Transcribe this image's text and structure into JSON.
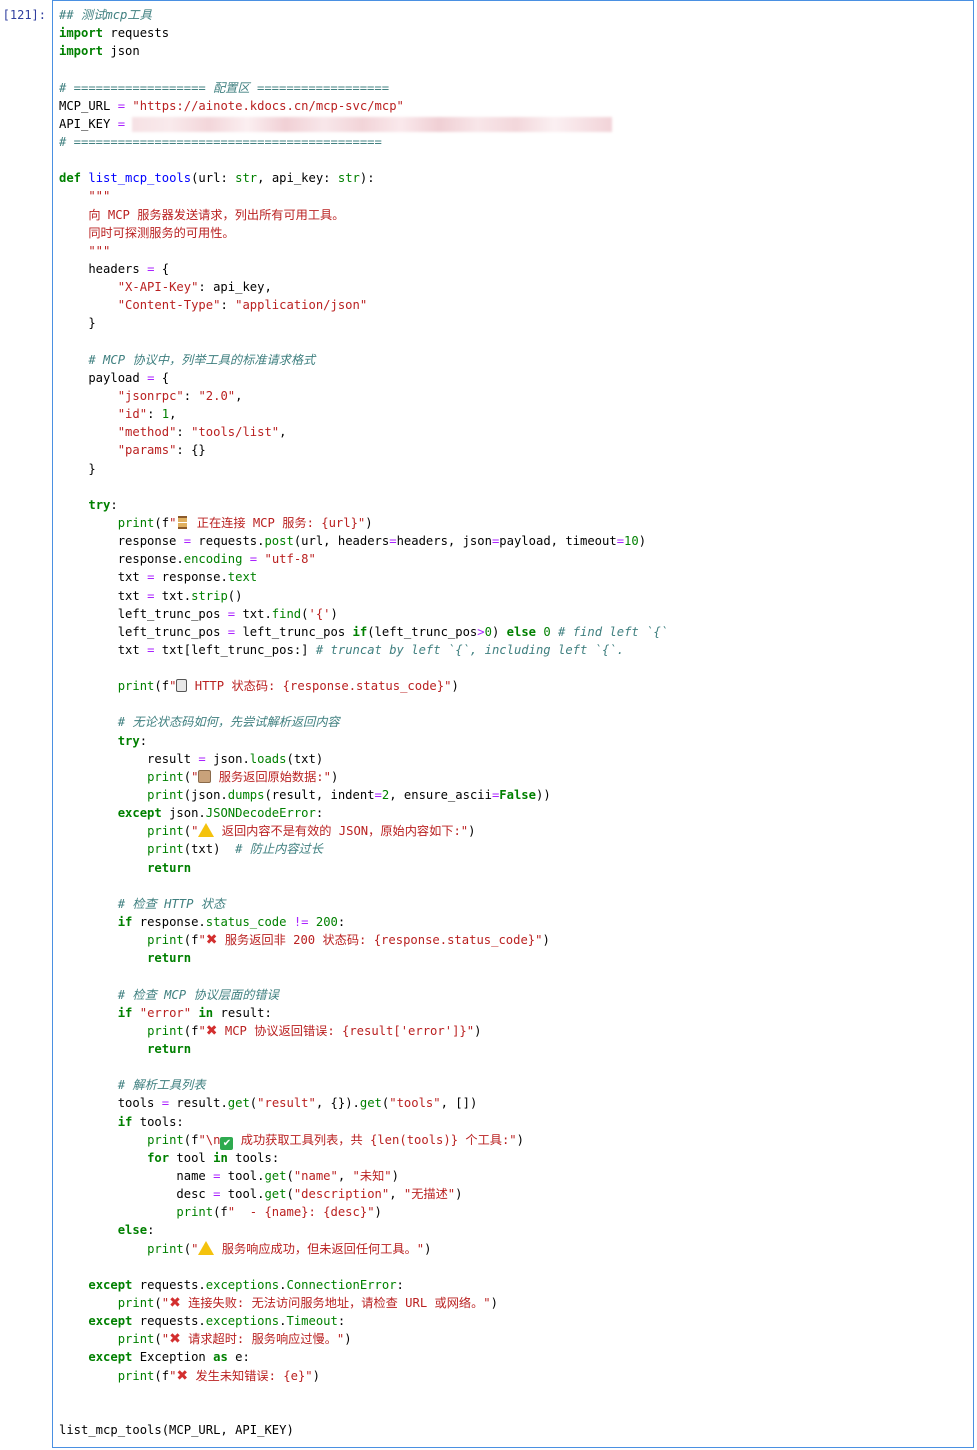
{
  "cell": {
    "prompt": "[121]:",
    "blank_line": " ",
    "code_lines": [
      "## 测试mcp工具",
      "import requests",
      "import json",
      "",
      "# ================== 配置区 ==================",
      "MCP_URL = \"https://ainote.kdocs.cn/mcp-svc/mcp\"",
      "API_KEY = ",
      "# ==========================================",
      "",
      "def list_mcp_tools(url: str, api_key: str):",
      "    \"\"\"",
      "    向 MCP 服务器发送请求，列出所有可用工具。",
      "    同时可探测服务的可用性。",
      "    \"\"\"",
      "    headers = {",
      "        \"X-API-Key\": api_key,",
      "        \"Content-Type\": \"application/json\"",
      "    }",
      "",
      "    # MCP 协议中，列举工具的标准请求格式",
      "    payload = {",
      "        \"jsonrpc\": \"2.0\",",
      "        \"id\": 1,",
      "        \"method\": \"tools/list\",",
      "        \"params\": {}",
      "    }",
      "",
      "    try:",
      "        print(f\"⏳ 正在连接 MCP 服务: {url}\")",
      "        response = requests.post(url, headers=headers, json=payload, timeout=10)",
      "        response.encoding = \"utf-8\"",
      "        txt = response.text",
      "        txt = txt.strip()",
      "        left_trunc_pos = txt.find('{')",
      "        left_trunc_pos = left_trunc_pos if(left_trunc_pos>0) else 0 # find left `{`",
      "        txt = txt[left_trunc_pos:] # truncat by left `{`, including left `{`.",
      "",
      "        print(f\"📱 HTTP 状态码: {response.status_code}\")",
      "",
      "        # 无论状态码如何，先尝试解析返回内容",
      "        try:",
      "            result = json.loads(txt)",
      "            print(\"📜 服务返回原始数据:\")",
      "            print(json.dumps(result, indent=2, ensure_ascii=False))",
      "        except json.JSONDecodeError:",
      "            print(\"⚠️ 返回内容不是有效的 JSON，原始内容如下:\")",
      "            print(txt)  # 防止内容过长",
      "            return",
      "",
      "        # 检查 HTTP 状态",
      "        if response.status_code != 200:",
      "            print(f\"❌ 服务返回非 200 状态码: {response.status_code}\")",
      "            return",
      "",
      "        # 检查 MCP 协议层面的错误",
      "        if \"error\" in result:",
      "            print(f\"❌ MCP 协议返回错误: {result['error']}\")",
      "            return",
      "",
      "        # 解析工具列表",
      "        tools = result.get(\"result\", {}).get(\"tools\", [])",
      "        if tools:",
      "            print(f\"\\n✅ 成功获取工具列表，共 {len(tools)} 个工具:\")",
      "            for tool in tools:",
      "                name = tool.get(\"name\", \"未知\")",
      "                desc = tool.get(\"description\", \"无描述\")",
      "                print(f\"  - {name}: {desc}\")",
      "        else:",
      "            print(\"⚠️ 服务响应成功，但未返回任何工具。\")",
      "",
      "    except requests.exceptions.ConnectionError:",
      "        print(\"❌ 连接失败: 无法访问服务地址，请检查 URL 或网络。\")",
      "    except requests.exceptions.Timeout:",
      "        print(\"❌ 请求超时: 服务响应过慢。\")",
      "    except Exception as e:",
      "        print(f\"❌ 发生未知错误: {e}\")",
      "",
      "",
      "list_mcp_tools(MCP_URL, API_KEY)"
    ]
  },
  "colors": {
    "keyword": "#008000",
    "string": "#ba2121",
    "comment": "#408080",
    "function": "#0000ff",
    "prompt": "#303f9f",
    "cell_border": "#4a90e2"
  }
}
